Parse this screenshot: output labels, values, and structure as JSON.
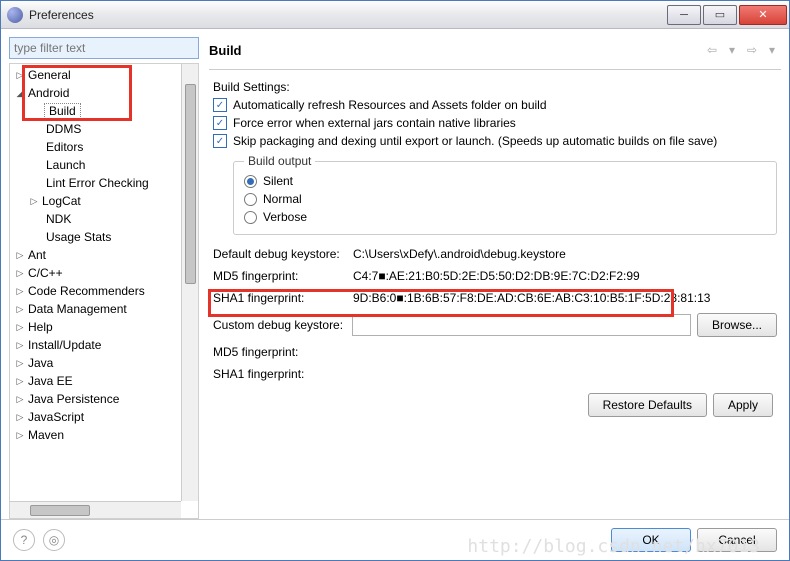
{
  "window": {
    "title": "Preferences"
  },
  "filter": {
    "placeholder": "type filter text"
  },
  "tree": {
    "general": "General",
    "android": "Android",
    "build": "Build",
    "ddms": "DDMS",
    "editors": "Editors",
    "launch": "Launch",
    "lint": "Lint Error Checking",
    "logcat": "LogCat",
    "ndk": "NDK",
    "usage": "Usage Stats",
    "ant": "Ant",
    "ccpp": "C/C++",
    "coderec": "Code Recommenders",
    "datamgmt": "Data Management",
    "help": "Help",
    "install": "Install/Update",
    "java": "Java",
    "javaee": "Java EE",
    "javapersist": "Java Persistence",
    "javascript": "JavaScript",
    "maven": "Maven"
  },
  "page": {
    "title": "Build",
    "settingsLabel": "Build Settings:",
    "chk1": "Automatically refresh Resources and Assets folder on build",
    "chk2": "Force error when external jars contain native libraries",
    "chk3": "Skip packaging and dexing until export or launch. (Speeds up automatic builds on file save)",
    "buildout_legend": "Build output",
    "silent": "Silent",
    "normal": "Normal",
    "verbose": "Verbose",
    "defaultKeystoreLabel": "Default debug keystore:",
    "defaultKeystoreVal": "C:\\Users\\xDefy\\.android\\debug.keystore",
    "md5Label": "MD5 fingerprint:",
    "md5Val": "C4:7■:AE:21:B0:5D:2E:D5:50:D2:DB:9E:7C:D2:F2:99",
    "sha1Label": "SHA1 fingerprint:",
    "sha1Val": "9D:B6:0■:1B:6B:57:F8:DE:AD:CB:6E:AB:C3:10:B5:1F:5D:28:81:13",
    "customKeystoreLabel": "Custom debug keystore:",
    "md5Label2": "MD5 fingerprint:",
    "sha1Label2": "SHA1 fingerprint:",
    "browse": "Browse...",
    "restore": "Restore Defaults",
    "apply": "Apply"
  },
  "footer": {
    "ok": "OK",
    "cancel": "Cancel"
  },
  "watermark": "http://blog.csdn.net/hx7013"
}
